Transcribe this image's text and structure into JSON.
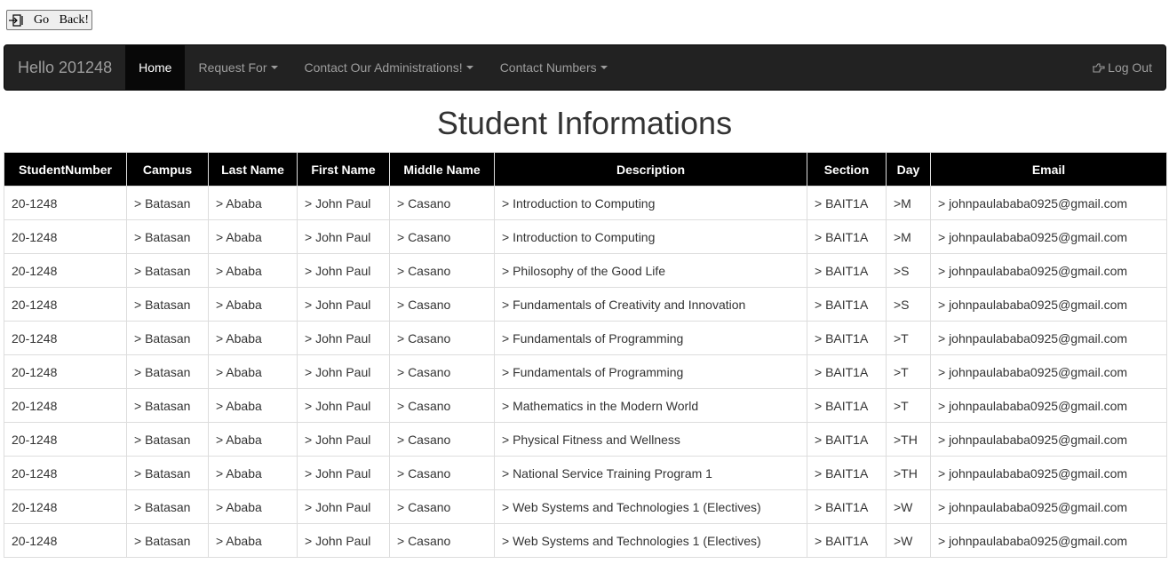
{
  "go_back": {
    "label": "Go Back!",
    "icon": "door-exit-icon"
  },
  "navbar": {
    "brand": "Hello 201248",
    "items": [
      {
        "label": "Home",
        "active": true,
        "dropdown": false
      },
      {
        "label": "Request For",
        "active": false,
        "dropdown": true
      },
      {
        "label": "Contact Our Administrations!",
        "active": false,
        "dropdown": true
      },
      {
        "label": "Contact Numbers",
        "active": false,
        "dropdown": true
      }
    ],
    "logout": {
      "label": "Log Out",
      "icon": "hand-point-right-icon"
    },
    "colors": {
      "background": "#222222",
      "active": "#080808",
      "text": "#9d9d9d"
    }
  },
  "page_title": "Student Informations",
  "table": {
    "headers": [
      "StudentNumber",
      "Campus",
      "Last Name",
      "First Name",
      "Middle Name",
      "Description",
      "Section",
      "Day",
      "Email"
    ],
    "rows": [
      [
        "20-1248",
        "> Batasan",
        "> Ababa",
        "> John Paul",
        "> Casano",
        "> Introduction to Computing",
        "> BAIT1A",
        ">M",
        "> johnpaulababa0925@gmail.com"
      ],
      [
        "20-1248",
        "> Batasan",
        "> Ababa",
        "> John Paul",
        "> Casano",
        "> Introduction to Computing",
        "> BAIT1A",
        ">M",
        "> johnpaulababa0925@gmail.com"
      ],
      [
        "20-1248",
        "> Batasan",
        "> Ababa",
        "> John Paul",
        "> Casano",
        "> Philosophy of the Good Life",
        "> BAIT1A",
        ">S",
        "> johnpaulababa0925@gmail.com"
      ],
      [
        "20-1248",
        "> Batasan",
        "> Ababa",
        "> John Paul",
        "> Casano",
        "> Fundamentals of Creativity and Innovation",
        "> BAIT1A",
        ">S",
        "> johnpaulababa0925@gmail.com"
      ],
      [
        "20-1248",
        "> Batasan",
        "> Ababa",
        "> John Paul",
        "> Casano",
        "> Fundamentals of Programming",
        "> BAIT1A",
        ">T",
        "> johnpaulababa0925@gmail.com"
      ],
      [
        "20-1248",
        "> Batasan",
        "> Ababa",
        "> John Paul",
        "> Casano",
        "> Fundamentals of Programming",
        "> BAIT1A",
        ">T",
        "> johnpaulababa0925@gmail.com"
      ],
      [
        "20-1248",
        "> Batasan",
        "> Ababa",
        "> John Paul",
        "> Casano",
        "> Mathematics in the Modern World",
        "> BAIT1A",
        ">T",
        "> johnpaulababa0925@gmail.com"
      ],
      [
        "20-1248",
        "> Batasan",
        "> Ababa",
        "> John Paul",
        "> Casano",
        "> Physical Fitness and Wellness",
        "> BAIT1A",
        ">TH",
        "> johnpaulababa0925@gmail.com"
      ],
      [
        "20-1248",
        "> Batasan",
        "> Ababa",
        "> John Paul",
        "> Casano",
        "> National Service Training Program 1",
        "> BAIT1A",
        ">TH",
        "> johnpaulababa0925@gmail.com"
      ],
      [
        "20-1248",
        "> Batasan",
        "> Ababa",
        "> John Paul",
        "> Casano",
        "> Web Systems and Technologies 1 (Electives)",
        "> BAIT1A",
        ">W",
        "> johnpaulababa0925@gmail.com"
      ],
      [
        "20-1248",
        "> Batasan",
        "> Ababa",
        "> John Paul",
        "> Casano",
        "> Web Systems and Technologies 1 (Electives)",
        "> BAIT1A",
        ">W",
        "> johnpaulababa0925@gmail.com"
      ]
    ],
    "header_color": "#000000"
  }
}
